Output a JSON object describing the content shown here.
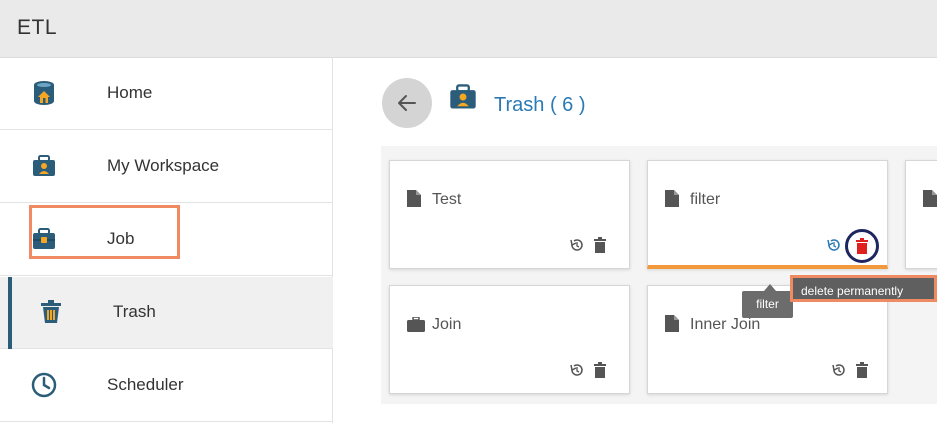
{
  "app": {
    "title": "ETL"
  },
  "sidebar": {
    "items": [
      {
        "label": "Home",
        "icon": "home-database-icon"
      },
      {
        "label": "My Workspace",
        "icon": "briefcase-user-icon"
      },
      {
        "label": "Job",
        "icon": "briefcase-icon"
      },
      {
        "label": "Trash",
        "icon": "trash-icon",
        "active": true
      },
      {
        "label": "Scheduler",
        "icon": "clock-icon"
      }
    ]
  },
  "main": {
    "title": "Trash ( 6 )",
    "cards": [
      {
        "name": "Test",
        "icon": "file-icon"
      },
      {
        "name": "filter",
        "icon": "file-icon",
        "selected": true
      },
      {
        "name": "Join",
        "icon": "briefcase-icon"
      },
      {
        "name": "Inner Join",
        "icon": "file-icon"
      }
    ]
  },
  "tooltips": {
    "filter": "filter",
    "delete": "delete permanently"
  },
  "colors": {
    "accent": "#2a7ab5",
    "highlight": "#ef8a62",
    "selected_underline": "#f29a3b",
    "delete_red": "#e0201f",
    "sidebar_active_bar": "#2b5d7a"
  }
}
